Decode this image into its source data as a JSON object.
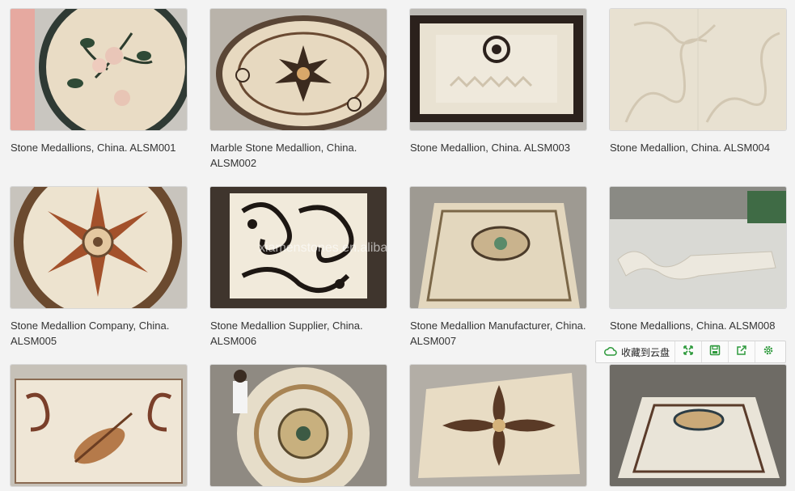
{
  "products": [
    {
      "caption": "Stone Medallions, China. ALSM001"
    },
    {
      "caption": "Marble Stone Medallion, China. ALSM002"
    },
    {
      "caption": "Stone Medallion, China. ALSM003"
    },
    {
      "caption": "Stone Medallion, China. ALSM004"
    },
    {
      "caption": "Stone Medallion Company, China. ALSM005"
    },
    {
      "caption": "Stone Medallion Supplier, China. ALSM006"
    },
    {
      "caption": "Stone Medallion Manufacturer, China. ALSM007"
    },
    {
      "caption": "Stone Medallions, China. ALSM008"
    },
    {
      "caption": ""
    },
    {
      "caption": ""
    },
    {
      "caption": ""
    },
    {
      "caption": ""
    }
  ],
  "watermark": "xiamenstones.en.alibaba.com",
  "toolbar": {
    "save_label": "收藏到云盘",
    "icons": [
      "cloud-icon",
      "expand-icon",
      "save-disk-icon",
      "share-icon",
      "settings-gear-icon"
    ]
  },
  "colors": {
    "accent": "#2e9a3c",
    "caption_text": "#333333",
    "background": "#f3f3f3"
  }
}
